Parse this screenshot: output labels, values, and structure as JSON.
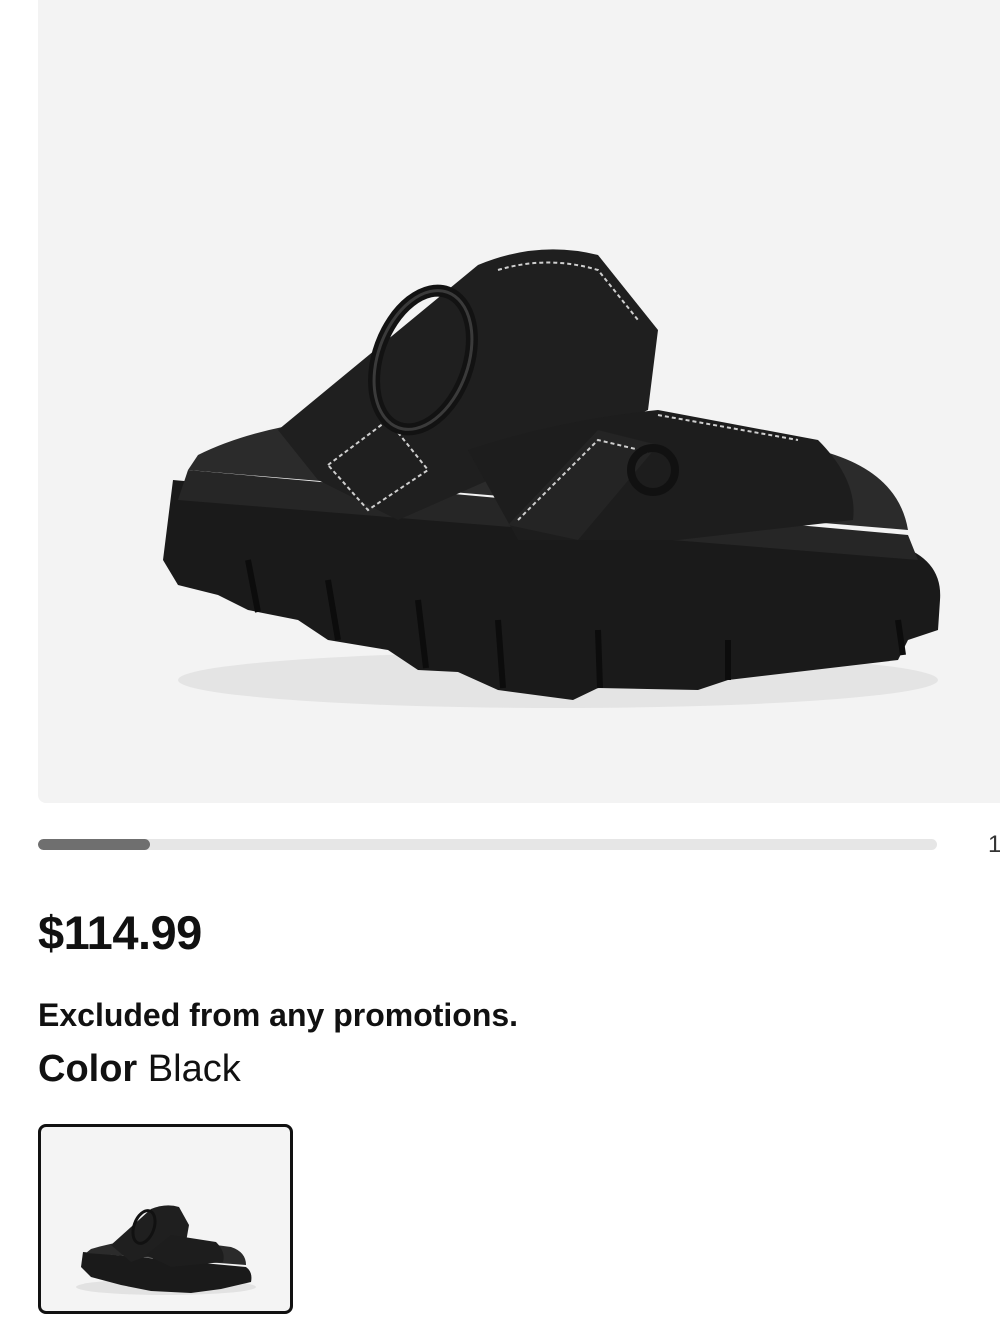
{
  "product": {
    "image_alt": "Black chunky lug-sole slide sandal with two stitched straps and ring buckle",
    "gallery": {
      "current": 1,
      "progress_fraction": 0.125,
      "counter_text": "1"
    },
    "price": "$114.99",
    "promo_note": "Excluded from any promotions.",
    "color": {
      "label": "Color",
      "value": "Black"
    },
    "swatches": [
      {
        "name": "Black",
        "selected": true
      }
    ]
  },
  "colors": {
    "sandal": "#1c1c1c",
    "background": "#f3f3f3",
    "progress_fill": "#6f6f6f",
    "progress_track": "#e6e6e6"
  }
}
